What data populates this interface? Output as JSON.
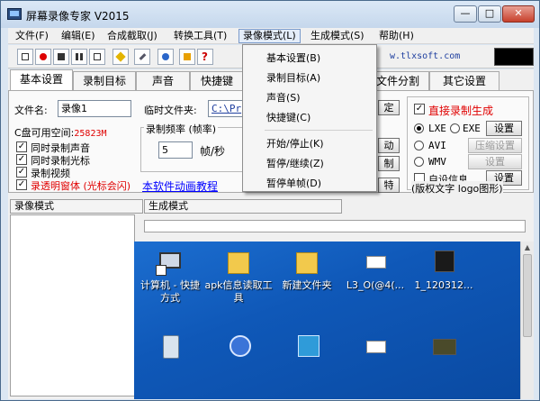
{
  "window": {
    "title": "屏幕录像专家 V2015"
  },
  "caption": {
    "minimize": "—",
    "maximize": "□",
    "close": "✕"
  },
  "menubar": {
    "items": [
      "文件(F)",
      "编辑(E)",
      "合成截取(J)",
      "转换工具(T)",
      "录像模式(L)",
      "生成模式(S)",
      "帮助(H)"
    ]
  },
  "toolbar": {
    "url": "w.tlxsoft.com"
  },
  "dropdown": {
    "items": [
      "基本设置(B)",
      "录制目标(A)",
      "声音(S)",
      "快捷键(C)",
      "开始/停止(K)",
      "暂停/继续(Z)",
      "暂停单帧(D)"
    ]
  },
  "tabs": [
    "基本设置",
    "录制目标",
    "声音",
    "快捷键",
    "文件分割",
    "其它设置"
  ],
  "basic": {
    "filename_label": "文件名:",
    "filename_value": "录像1",
    "tempdir_label": "临时文件夹:",
    "tempdir_value": "C:\\Pr",
    "disk_label": "C盘可用空间:",
    "disk_value": "25823M",
    "cb_audio": "同时录制声音",
    "cb_cursor": "同时录制光标",
    "cb_video": "录制视频",
    "cb_transparent": "录透明窗体 (光标会闪)",
    "tutorial_link": "本软件动画教程",
    "fps_group": "录制频率 (帧率)",
    "fps_value": "5",
    "fps_unit": "帧/秒",
    "partial_btn1": "定",
    "partial_btn2": "动",
    "partial_btn3": "制",
    "partial_btn4": "特"
  },
  "output": {
    "direct_label": "直接录制生成",
    "lxe": "LXE",
    "exe": "EXE",
    "setup": "设置",
    "avi": "AVI",
    "compress": "压缩设置",
    "wmv": "WMV",
    "setup2": "设置",
    "custom_info": "自设信息",
    "setup3": "设置",
    "copyright": "(版权文字 logo图形)"
  },
  "split": {
    "left": "录像模式",
    "right": "生成模式"
  },
  "desktop": {
    "icons": [
      {
        "label": "计算机 - 快捷方式"
      },
      {
        "label": "apk信息读取工具"
      },
      {
        "label": "新建文件夹"
      },
      {
        "label": "L3_O(@4(..."
      },
      {
        "label": "1_120312..."
      }
    ]
  },
  "colors": {
    "red_text": "#e00000",
    "link": "#0000ff",
    "desktop": "#0f58b8"
  }
}
